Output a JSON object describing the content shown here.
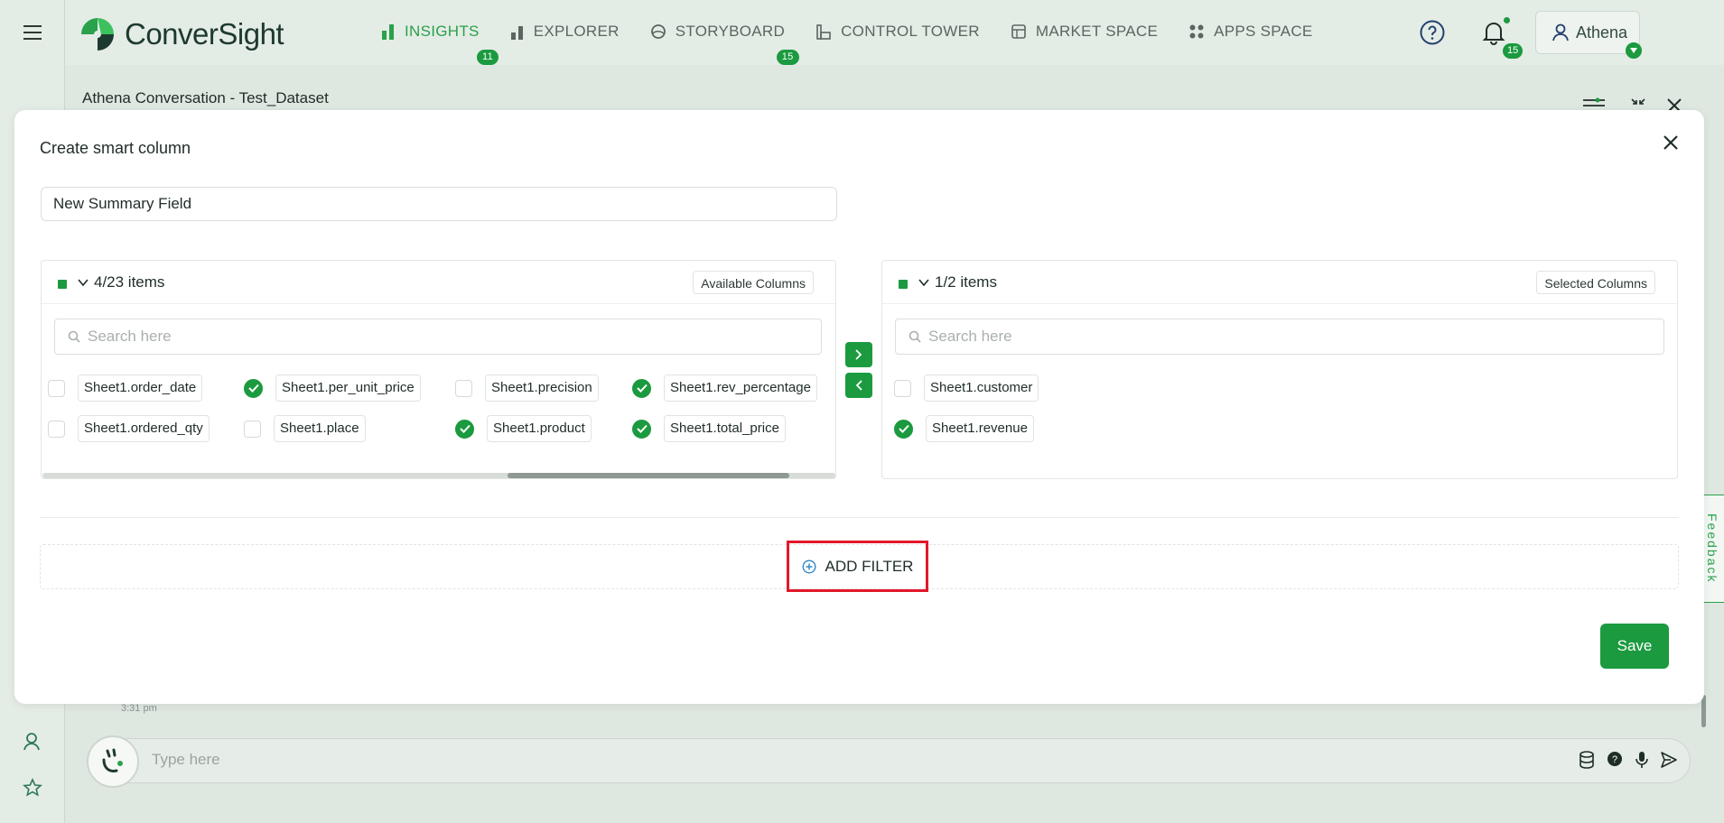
{
  "brand": {
    "name": "ConverSight",
    "accent": "#1b9a3f"
  },
  "nav": {
    "items": [
      {
        "label": "INSIGHTS",
        "badge": "11",
        "icon": "bar-chart-icon"
      },
      {
        "label": "EXPLORER",
        "badge": "",
        "icon": "explorer-icon"
      },
      {
        "label": "STORYBOARD",
        "badge": "15",
        "icon": "storyboard-icon"
      },
      {
        "label": "CONTROL TOWER",
        "badge": "",
        "icon": "control-tower-icon"
      },
      {
        "label": "MARKET SPACE",
        "badge": "",
        "icon": "market-space-icon"
      },
      {
        "label": "APPS SPACE",
        "badge": "",
        "icon": "apps-space-icon"
      }
    ]
  },
  "header": {
    "notifications_count": "15",
    "user_name": "Athena"
  },
  "conversation": {
    "title": "Athena Conversation - Test_Dataset",
    "timestamp": "3:31 pm",
    "input_placeholder": "Type here"
  },
  "modal": {
    "title": "Create smart column",
    "name_value": "New Summary Field",
    "available": {
      "count_label": "4/23 items",
      "tag": "Available Columns",
      "search_placeholder": "Search here",
      "items": [
        {
          "label": "Sheet1.order_date",
          "checked": false
        },
        {
          "label": "Sheet1.per_unit_price",
          "checked": true
        },
        {
          "label": "Sheet1.precision",
          "checked": false
        },
        {
          "label": "Sheet1.rev_percentage",
          "checked": true
        },
        {
          "label": "Sheet1.ordered_qty",
          "checked": false
        },
        {
          "label": "Sheet1.place",
          "checked": false
        },
        {
          "label": "Sheet1.product",
          "checked": true
        },
        {
          "label": "Sheet1.total_price",
          "checked": true
        }
      ]
    },
    "selected": {
      "count_label": "1/2 items",
      "tag": "Selected Columns",
      "search_placeholder": "Search here",
      "items": [
        {
          "label": "Sheet1.customer",
          "checked": false
        },
        {
          "label": "Sheet1.revenue",
          "checked": true
        }
      ]
    },
    "add_filter_label": "ADD FILTER",
    "save_label": "Save"
  },
  "feedback_label": "Feedback"
}
